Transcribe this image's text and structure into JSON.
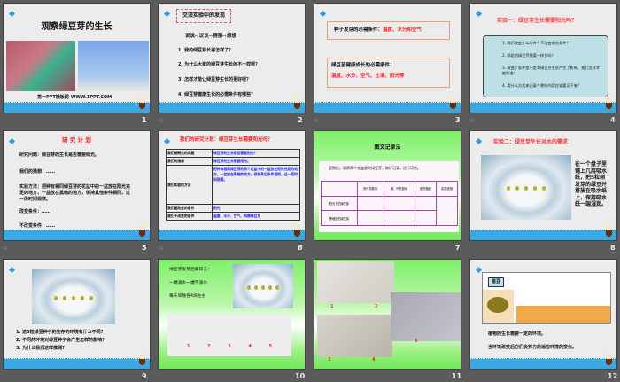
{
  "slides": [
    {
      "number": "1",
      "title": "观察绿豆芽的生长",
      "footer": "第一PPT模板网-WWW.1PPT.COM"
    },
    {
      "number": "2",
      "heading": "交流实验中的发现",
      "subheading": "说说⇨议议⇨猜猜⇨想想",
      "items": [
        "1. 我的绿豆芽长得怎样了？",
        "2. 为什么大家的绿豆芽生长的不一样呢？",
        "3. 怎样才能让绿豆芽生长的更好呢？",
        "4. 绿豆芽健康生长的必需条件有哪些？"
      ]
    },
    {
      "number": "3",
      "box1_label": "种子发芽的必需条件：",
      "box1_value": "温度、水分和空气",
      "box2_label": "绿豆苗健康成长的必需条件：",
      "box2_value": "温度、水分、空气、土壤、阳光等"
    },
    {
      "number": "4",
      "title": "实验一：绿豆芽生长需要阳光吗？",
      "items": [
        "1. 我们改变什么条件？不改变哪些条件？",
        "2. 两组的绿豆芽需要一样多吗？",
        "3. 改变了条件是不是对绿豆芽生长产生了影响，我们怎样才能知道？",
        "4. 用什么方式来记录？哪些内容应该要记下来？"
      ]
    },
    {
      "number": "5",
      "title": "研 究 计 划",
      "lines": [
        "研究问题：绿豆芽的生长是否需要阳光。",
        "我们的猜想：……",
        "实验方法：把种有相同绿豆芽的花盆中的一盆放在阳光充足的地方，一盆放在黑暗的地方，保持其他条件相同，过一段时间观察。",
        "改变条件：……",
        "不改变条件：……"
      ]
    },
    {
      "number": "6",
      "title": "我们的研究计划：绿豆芽生长需要阳光吗？",
      "rows": [
        [
          "我们想研究的问题",
          "绿豆芽的生长是否需要阳光？"
        ],
        [
          "我们的猜想",
          "绿豆芽的生长需要阳光。"
        ],
        [
          "我们实验的方法",
          "把种有相同绿豆芽的两个花盆中的一盆放在阳光充足的地方，一盆放在黑暗的地方，保持其它条件相同，过一段时间观察。"
        ],
        [
          "我们要改变的条件",
          "阳光"
        ],
        [
          "我们不改变的条件",
          "温度、水分、空气、两颗绿豆芽"
        ]
      ]
    },
    {
      "number": "7",
      "title": "图文记录法",
      "intro": "一星期后，观察两个花盆里的绿豆芽，做好记录，进行研究。",
      "headers": [
        "",
        "种子总数量",
        "茎、叶的颜色",
        "茎的粗细",
        "实验说明"
      ],
      "row_labels": [
        "阳光下的绿豆芽",
        "黑暗处的绿豆芽"
      ]
    },
    {
      "number": "8",
      "title": "实验二：绿豆芽生长对水的需求",
      "text": "在一个盘子里铺上几层吸水纸，把5粒刚发芽的绿豆并排放在吸水纸上，保持吸水纸一端湿润。"
    },
    {
      "number": "9",
      "items": [
        "1. 这5粒绿豆种子的生存的环境有什么不同?",
        "2. 不同的环境对绿豆种子会产生怎样的影响?",
        "3. 为什么我们这样推测?"
      ]
    },
    {
      "number": "10",
      "lines": [
        "绿豆芽发芽后第四天：",
        "一端滴水一端不滴水",
        "每天早晚各4滴左右"
      ],
      "labels": [
        "1",
        "2",
        "3",
        "4",
        "5"
      ]
    },
    {
      "number": "11",
      "labels": [
        "1",
        "2",
        "3",
        "4",
        "5"
      ]
    },
    {
      "number": "12",
      "tag": "蚕豆",
      "lines": [
        "植物的生长需要一定的环境。",
        "当环境改变后它们会努力的适应环境的变化。"
      ]
    }
  ],
  "anim_icon": "☆"
}
